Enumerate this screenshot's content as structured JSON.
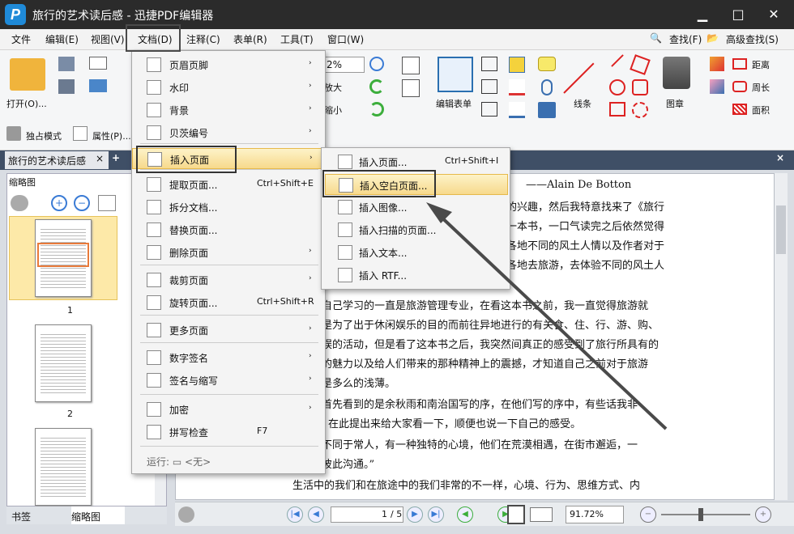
{
  "window": {
    "title": "旅行的艺术读后感 - 迅捷PDF编辑器",
    "logo": "P"
  },
  "menubar": {
    "items": [
      "文件",
      "编辑(E)",
      "视图(V)",
      "文档(D)",
      "注释(C)",
      "表单(R)",
      "工具(T)",
      "窗口(W)"
    ],
    "search": "查找(F)",
    "advanced_search": "高级查找(S)"
  },
  "ribbon": {
    "open": "打开(O)...",
    "exclusive_mode": "独占模式",
    "properties": "属性(P)...",
    "zoom": "2%",
    "enlarge": "放大",
    "shrink": "缩小",
    "edit_form": "编辑表单",
    "line": "线条",
    "stamp": "图章",
    "distance": "距离",
    "perimeter": "周长",
    "area": "面积"
  },
  "tabs": {
    "doc_tab": "旅行的艺术读后感",
    "close": "×",
    "add": "+"
  },
  "left_panel": {
    "title": "缩略图",
    "pages": [
      "1",
      "2"
    ],
    "bottom_tabs": [
      "书签",
      "缩略图"
    ]
  },
  "document": {
    "lines": [
      "——Alain De Botton",
      "的兴趣，然后我特意找来了《旅行",
      "一本书，一口气读完之后依然觉得",
      "各地不同的风土人情以及作者对于",
      "各地去旅游，去体验不同的风土人",
      "自己学习的一直是旅游管理专业，在看这本书之前，我一直觉得旅游就",
      "是为了出于休闲娱乐的目的而前往异地进行的有关食、住、行、游、购、",
      "娱的活动，但是看了这本书之后，我突然间真正的感受到了旅行所具有的",
      "的魅力以及给人们带来的那种精神上的震撼，才知道自己之前对于旅游",
      "是多么的浅薄。",
      "首先看到的是余秋雨和南治国写的序，在他们写的序中，有些话我非",
      "在此提出来给大家看一下，顺便也说一下自己的感受。",
      "不同于常人，有一种独特的心境，他们在荒漠相遇，在街市邂逅，一",
      "彼此沟通。”",
      "生活中的我们和在旅途中的我们非常的不一样，心境、行为、思维方式、内"
    ]
  },
  "doc_menu": {
    "items": [
      {
        "label": "页眉页脚",
        "key": "",
        "arrow": "›"
      },
      {
        "label": "水印",
        "key": "",
        "arrow": "›"
      },
      {
        "label": "背景",
        "key": "",
        "arrow": "›"
      },
      {
        "label": "贝茨编号",
        "key": "",
        "arrow": "›"
      },
      {
        "label": "插入页面",
        "key": "",
        "arrow": "›"
      },
      {
        "label": "提取页面...",
        "key": "Ctrl+Shift+E",
        "arrow": ""
      },
      {
        "label": "拆分文档...",
        "key": "",
        "arrow": ""
      },
      {
        "label": "替换页面...",
        "key": "",
        "arrow": ""
      },
      {
        "label": "删除页面",
        "key": "",
        "arrow": "›"
      },
      {
        "label": "裁剪页面",
        "key": "",
        "arrow": "›"
      },
      {
        "label": "旋转页面...",
        "key": "Ctrl+Shift+R",
        "arrow": ""
      },
      {
        "label": "更多页面",
        "key": "",
        "arrow": "›"
      },
      {
        "label": "数字签名",
        "key": "",
        "arrow": "›"
      },
      {
        "label": "签名与缩写",
        "key": "",
        "arrow": "›"
      },
      {
        "label": "加密",
        "key": "",
        "arrow": "›"
      },
      {
        "label": "拼写检查",
        "key": "F7",
        "arrow": ""
      },
      {
        "label": "运行: ▭ <无>",
        "key": "",
        "arrow": ""
      }
    ]
  },
  "submenu": {
    "items": [
      {
        "label": "插入页面...",
        "key": "Ctrl+Shift+I"
      },
      {
        "label": "插入空白页面...",
        "key": ""
      },
      {
        "label": "插入图像...",
        "key": ""
      },
      {
        "label": "插入扫描的页面...",
        "key": ""
      },
      {
        "label": "插入文本...",
        "key": ""
      },
      {
        "label": "插入 RTF...",
        "key": ""
      }
    ]
  },
  "statusbar": {
    "page_input": "1",
    "page_total": "/ 5",
    "zoom": "91.72%"
  },
  "colors": {
    "titlebar": "#2b2b2b",
    "highlight": "#f7d98c",
    "accent": "#1f8ad8"
  }
}
